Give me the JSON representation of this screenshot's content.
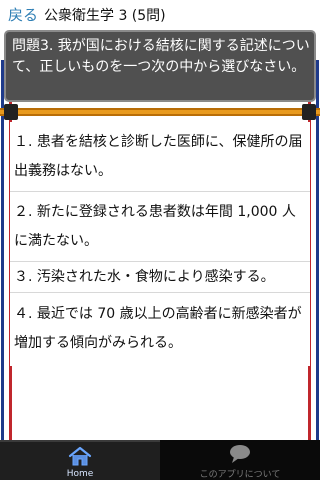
{
  "header": {
    "back_label": "戻る",
    "title": "公衆衛生学 3 (5問)"
  },
  "question": {
    "text": "問題3. 我が国における結核に関する記述について、正しいものを一つ次の中から選びなさい。"
  },
  "answers": [
    {
      "text": "１. 患者を結核と診断した医師に、保健所の届出義務はない。"
    },
    {
      "text": "２. 新たに登録される患者数は年間 1,000 人に満たない。"
    },
    {
      "text": "３. 汚染された水・食物により感染する。"
    },
    {
      "text": "４. 最近では 70 歳以上の高齢者に新感染者が増加する傾向がみられる。"
    }
  ],
  "tabbar": {
    "home_label": "Home",
    "about_label": "このアプリについて"
  },
  "colors": {
    "accent": "#2f7fb5",
    "question_bg": "#505050",
    "divider": "#e89a1e",
    "stripe_blue": "#1e3a8a",
    "stripe_red": "#c0262c",
    "tabbar_bg": "#0a0a0a"
  },
  "icons": {
    "home": "home-icon",
    "about": "speech-bubble-icon"
  }
}
